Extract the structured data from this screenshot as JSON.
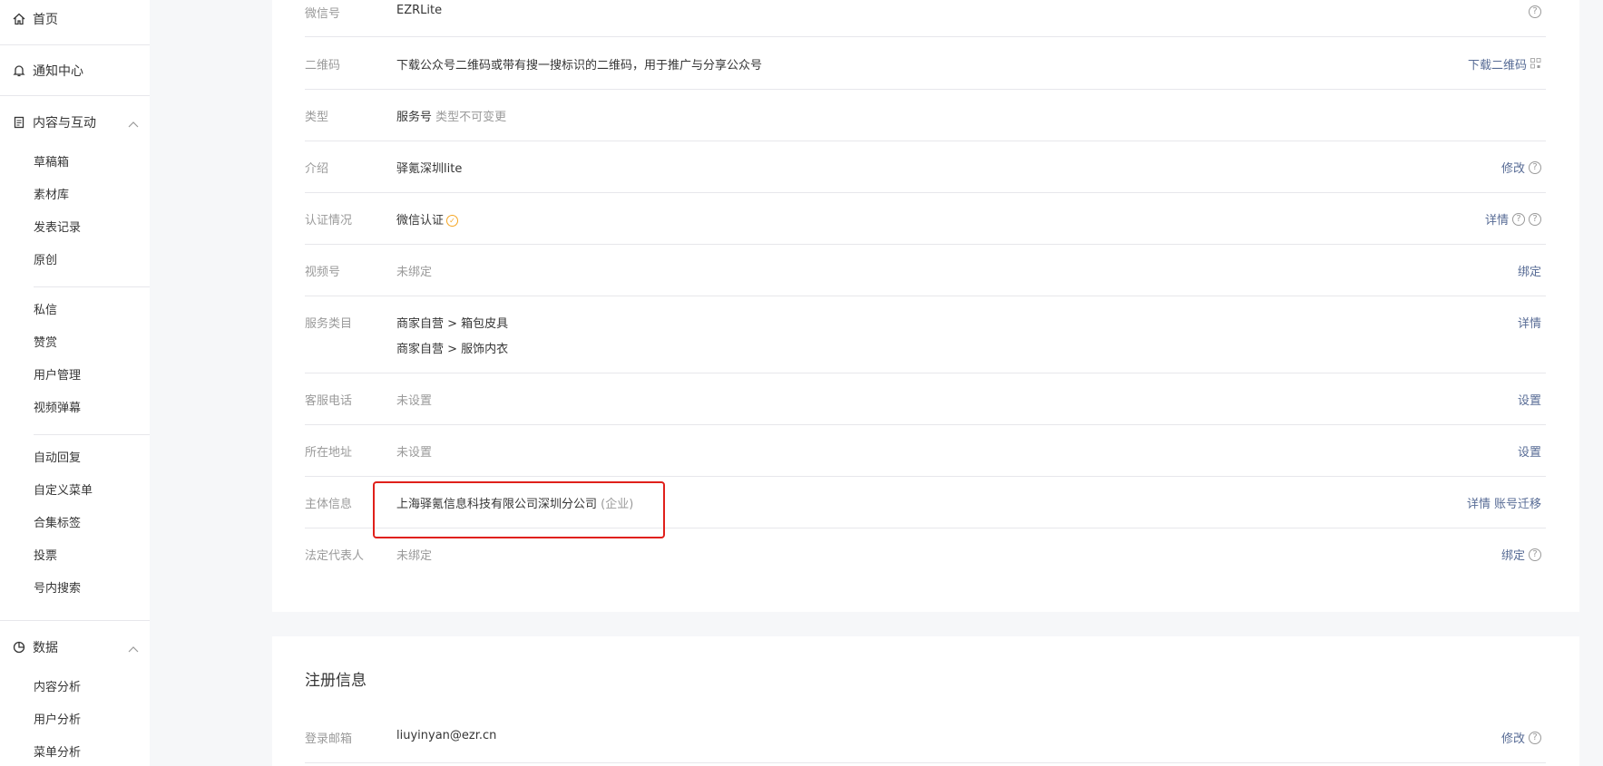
{
  "sidebar": {
    "home": "首页",
    "notifications": "通知中心",
    "content_group": "内容与互动",
    "content_items": [
      "草稿箱",
      "素材库",
      "发表记录",
      "原创"
    ],
    "interaction_items": [
      "私信",
      "赞赏",
      "用户管理",
      "视频弹幕"
    ],
    "feature_items": [
      "自动回复",
      "自定义菜单",
      "合集标签",
      "投票",
      "号内搜索"
    ],
    "data_group": "数据",
    "data_items": [
      "内容分析",
      "用户分析",
      "菜单分析"
    ]
  },
  "account": {
    "wechat_id": {
      "label": "微信号",
      "value": "EZRLite"
    },
    "qrcode": {
      "label": "二维码",
      "value": "下载公众号二维码或带有搜一搜标识的二维码，用于推广与分享公众号",
      "action": "下载二维码"
    },
    "type": {
      "label": "类型",
      "value": "服务号",
      "note": "类型不可变更"
    },
    "intro": {
      "label": "介绍",
      "value": "驿氪深圳lite",
      "action": "修改"
    },
    "verification": {
      "label": "认证情况",
      "value": "微信认证",
      "action": "详情"
    },
    "channels": {
      "label": "视频号",
      "value": "未绑定",
      "action": "绑定"
    },
    "service_category": {
      "label": "服务类目",
      "values": [
        "商家自营 > 箱包皮具",
        "商家自营 > 服饰内衣"
      ],
      "action": "详情"
    },
    "phone": {
      "label": "客服电话",
      "value": "未设置",
      "action": "设置"
    },
    "address": {
      "label": "所在地址",
      "value": "未设置",
      "action": "设置"
    },
    "entity": {
      "label": "主体信息",
      "value": "上海驿氪信息科技有限公司深圳分公司",
      "note": "(企业)",
      "action1": "详情",
      "action2": "账号迁移"
    },
    "legal_rep": {
      "label": "法定代表人",
      "value": "未绑定",
      "action": "绑定"
    }
  },
  "registration": {
    "title": "注册信息",
    "email": {
      "label": "登录邮箱",
      "value": "liuyinyan@ezr.cn",
      "action": "修改"
    }
  },
  "colors": {
    "link": "#576b95",
    "highlight": "#e0201b",
    "verified": "#f5a623"
  }
}
